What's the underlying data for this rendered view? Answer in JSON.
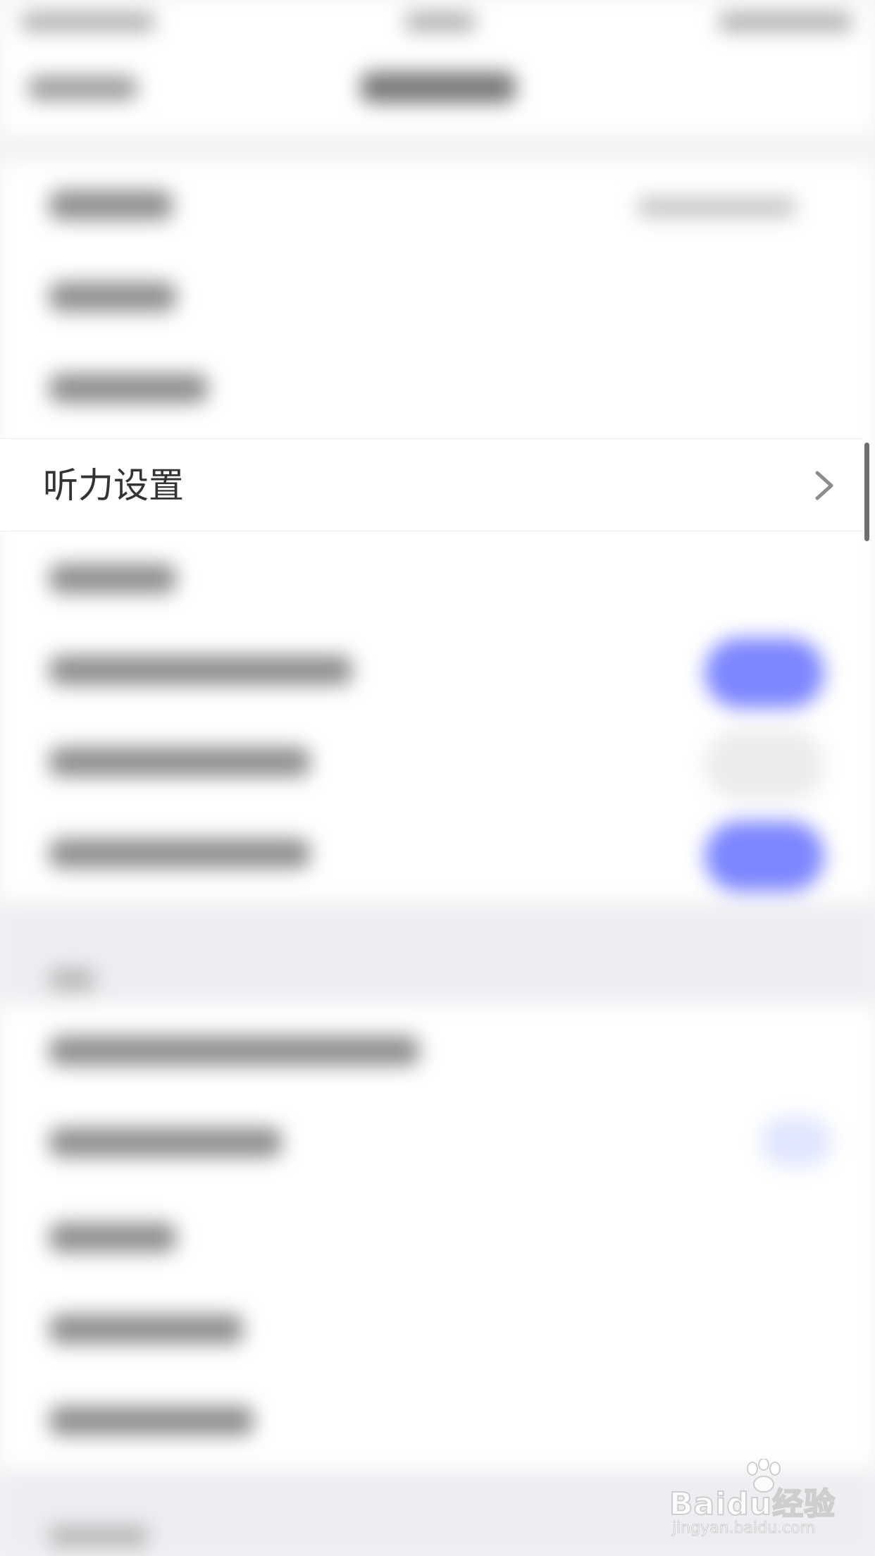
{
  "settings": {
    "focused_row": {
      "label": "听力设置",
      "chevron_icon": "chevron-right-icon"
    },
    "toggles_visible_states": [
      "on",
      "off",
      "on",
      "faint"
    ],
    "accent_color": "#7d86ff"
  },
  "watermark": {
    "brand": "Baidu经验",
    "url": "jingyan.baidu.com"
  }
}
